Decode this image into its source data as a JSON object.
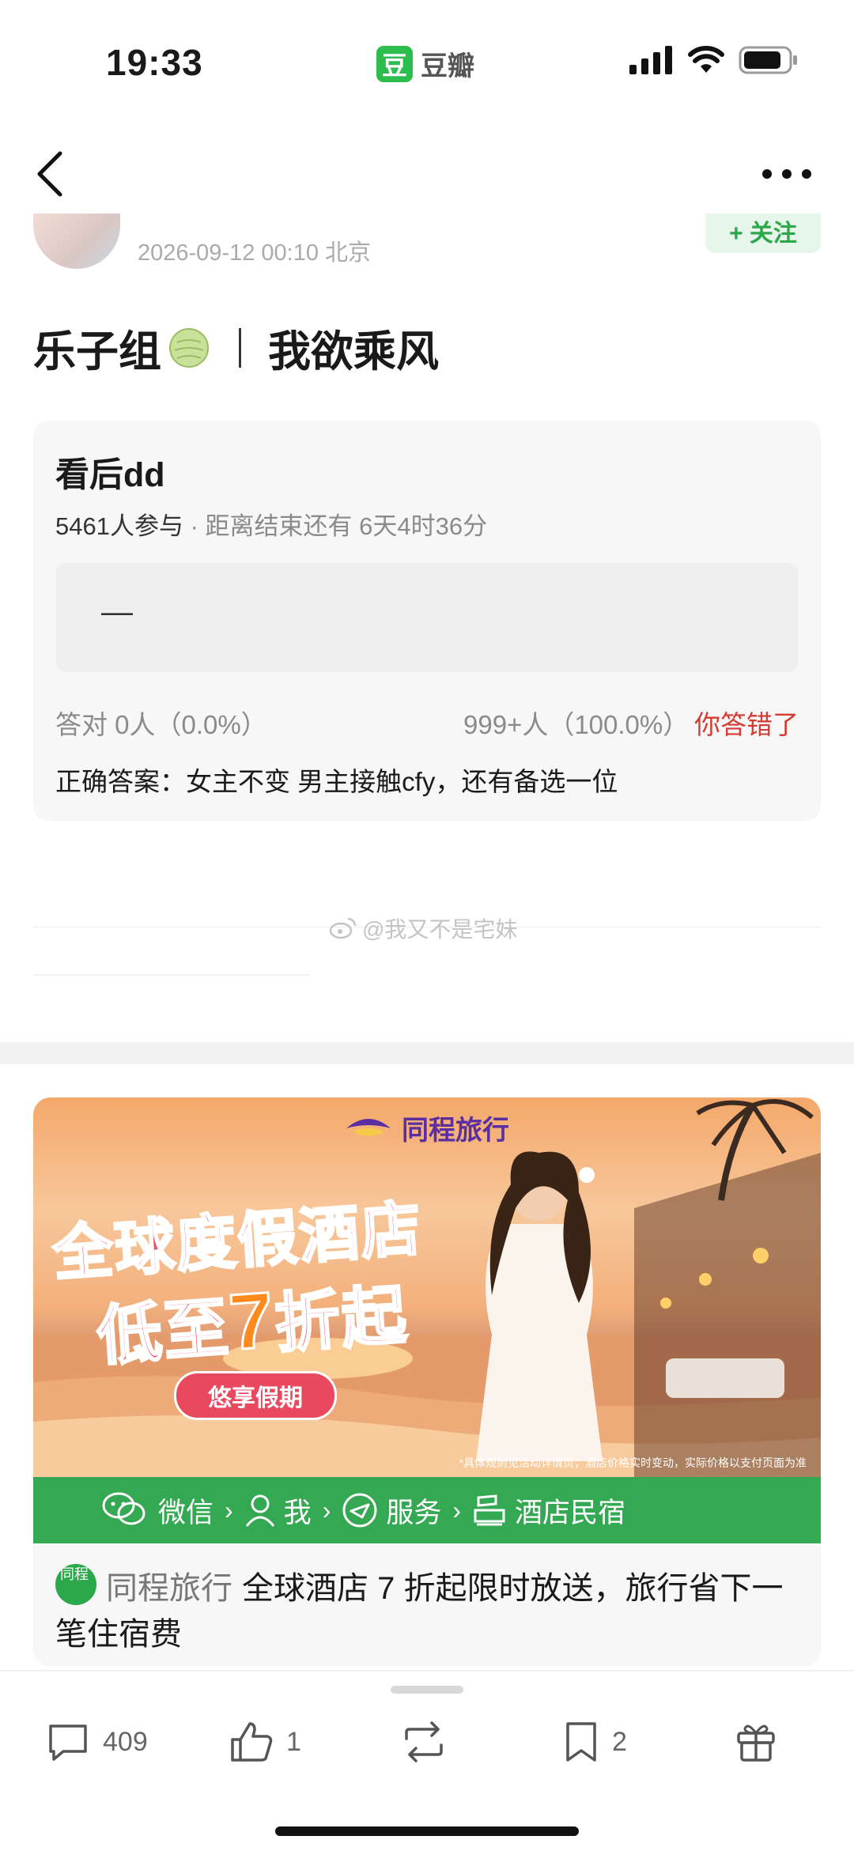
{
  "status_bar": {
    "time": "19:33",
    "app_logo_text": "豆",
    "app_name": "豆瓣"
  },
  "post": {
    "meta": "2026-09-12 00:10  北京",
    "follow_label": "+ 关注",
    "title_left": "乐子组",
    "title_right": "我欲乘风"
  },
  "quiz": {
    "title": "看后dd",
    "participants": "5461人参与",
    "separator": " · ",
    "time_left": "距离结束还有 6天4时36分",
    "option": "—",
    "correct_count": "答对  0人（0.0%）",
    "wrong_count": "999+人（100.0%）",
    "verdict": "你答错了",
    "answer": "正确答案：女主不变 男主接触cfy，还有备选一位"
  },
  "watermark": "@我又不是宅妹",
  "ad": {
    "brand": "同程旅行",
    "headline_line1": "全球度假酒店",
    "headline_line2_prefix": "低至",
    "headline_line2_num": "7",
    "headline_line2_suffix": "折起",
    "pill": "悠享假期",
    "disclaimer": "*具体规则见活动详情页；酒店价格实时变动，实际价格以支付页面为准",
    "strip": [
      "微信",
      "我",
      "服务",
      "酒店民宿"
    ],
    "caption_brand": "同程旅行",
    "caption_text": "全球酒店 7 折起限时放送，旅行省下一笔住宿费",
    "logo_text": "同程"
  },
  "actions": {
    "comments": "409",
    "likes": "1",
    "bookmarks": "2"
  },
  "colors": {
    "accent_green": "#2dbd4e",
    "wrong_red": "#d43c33",
    "ad_strip_green": "#35a853"
  }
}
